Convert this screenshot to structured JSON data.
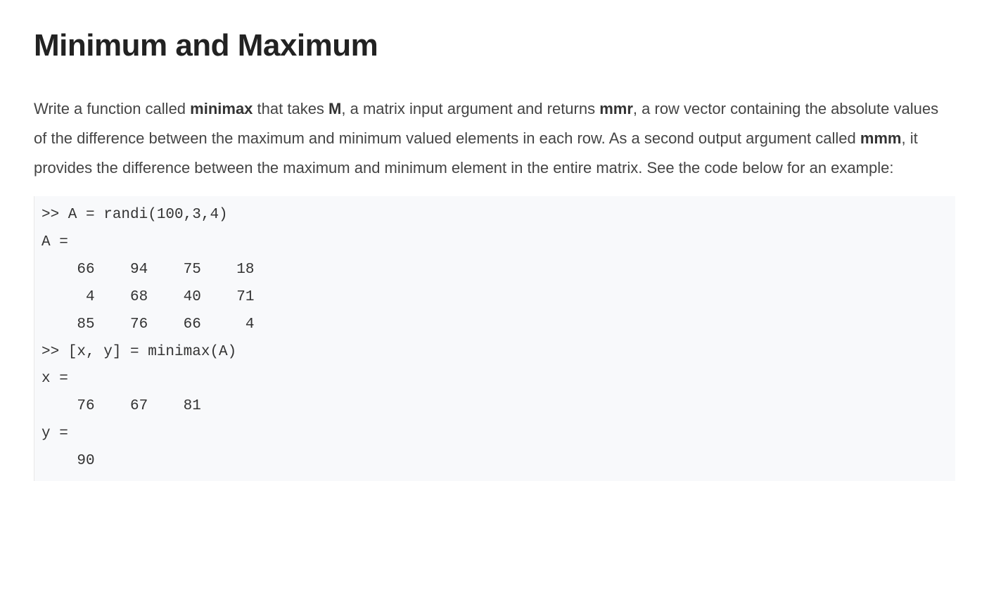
{
  "title": "Minimum and Maximum",
  "description": {
    "part1": "Write a function called ",
    "bold1": "minimax",
    "part2": " that takes ",
    "bold2": "M",
    "part3": ", a matrix input argument and returns ",
    "bold3": "mmr",
    "part4": ", a row vector containing the absolute values of the difference between the maximum and minimum valued elements in each row. As a second output argument called ",
    "bold4": "mmm",
    "part5": ", it provides the difference between the maximum and minimum element in the entire matrix. See the code below for an example:"
  },
  "code": ">> A = randi(100,3,4)\nA =\n    66    94    75    18\n     4    68    40    71\n    85    76    66     4\n>> [x, y] = minimax(A)\nx =\n    76    67    81\ny =\n    90"
}
